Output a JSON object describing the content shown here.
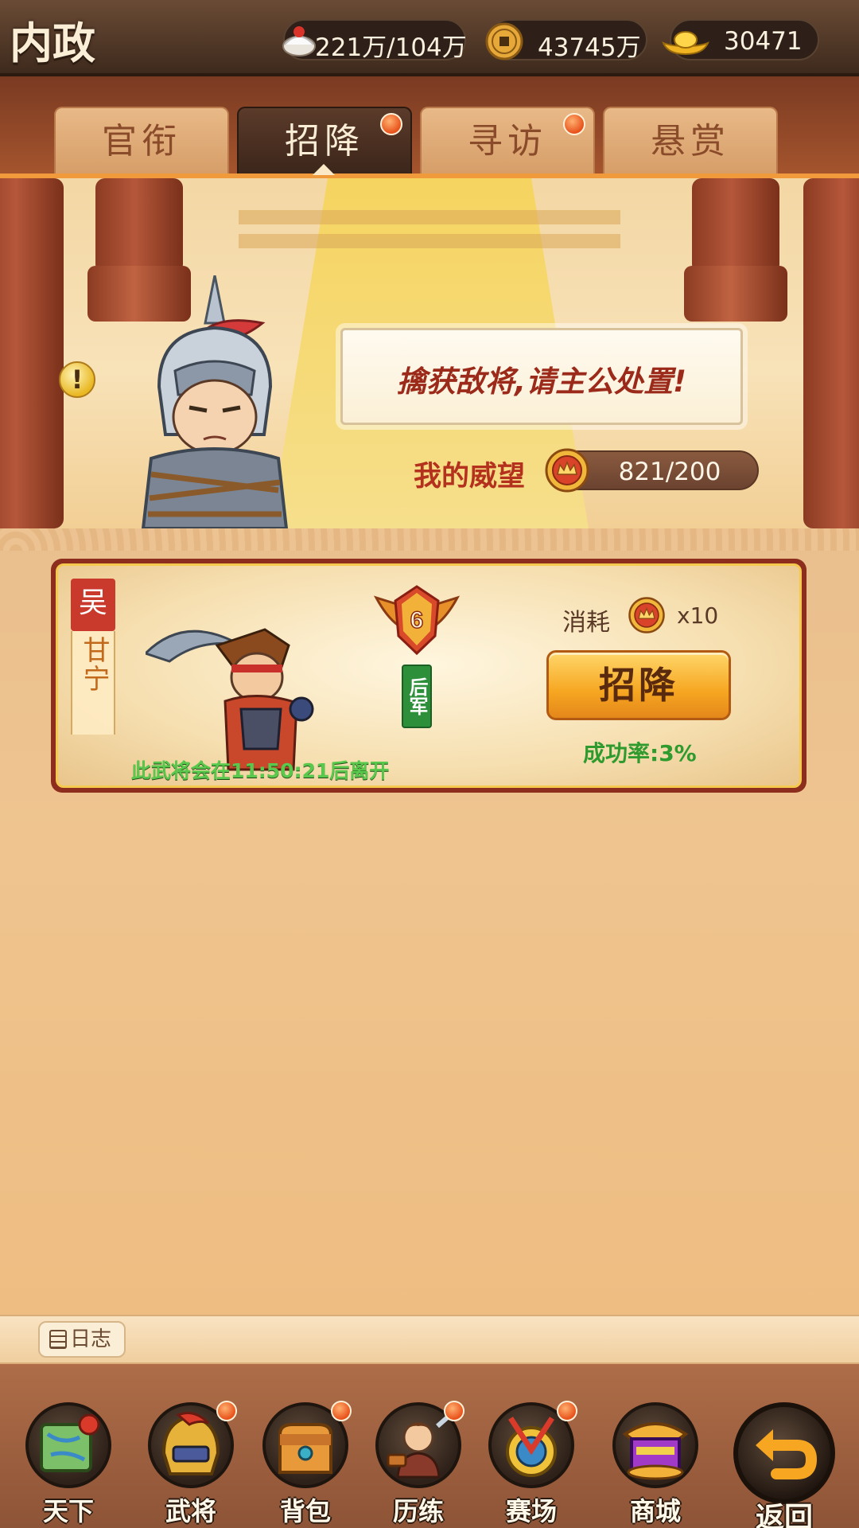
{
  "header": {
    "title": "内政",
    "resources": {
      "food": "221万/104万",
      "copper": "43745万",
      "gold": "30471"
    }
  },
  "tabs": [
    {
      "label": "官衔",
      "active": false,
      "badge": false
    },
    {
      "label": "招降",
      "active": true,
      "badge": true
    },
    {
      "label": "寻访",
      "active": false,
      "badge": true
    },
    {
      "label": "悬赏",
      "active": false,
      "badge": false
    }
  ],
  "scene": {
    "message": "擒获敌将,请主公处置!",
    "prestige_label": "我的威望",
    "prestige_value": "821/200",
    "alert_glyph": "!"
  },
  "card": {
    "faction": "吴",
    "general_name": "甘宁",
    "rank": "6",
    "troop_type": "后军",
    "cost_label": "消耗",
    "cost_qty": "x10",
    "recruit_label": "招降",
    "success_rate": "成功率:3%",
    "leave_timer": "此武将会在11:50:21后离开"
  },
  "log": {
    "label": "日志"
  },
  "nav": [
    {
      "label": "天下",
      "icon": "map-icon",
      "badge": false
    },
    {
      "label": "武将",
      "icon": "helmet-icon",
      "badge": true
    },
    {
      "label": "背包",
      "icon": "bag-icon",
      "badge": true
    },
    {
      "label": "历练",
      "icon": "training-icon",
      "badge": true
    },
    {
      "label": "赛场",
      "icon": "arena-icon",
      "badge": true
    },
    {
      "label": "商城",
      "icon": "shop-icon",
      "badge": false
    }
  ],
  "back": {
    "label": "返回",
    "icon": "return-arrow-icon"
  },
  "colors": {
    "accent_orange": "#f6a621",
    "badge_red": "#e8521b",
    "success_green": "#2f9a2d",
    "message_red": "#9b2a1a"
  }
}
